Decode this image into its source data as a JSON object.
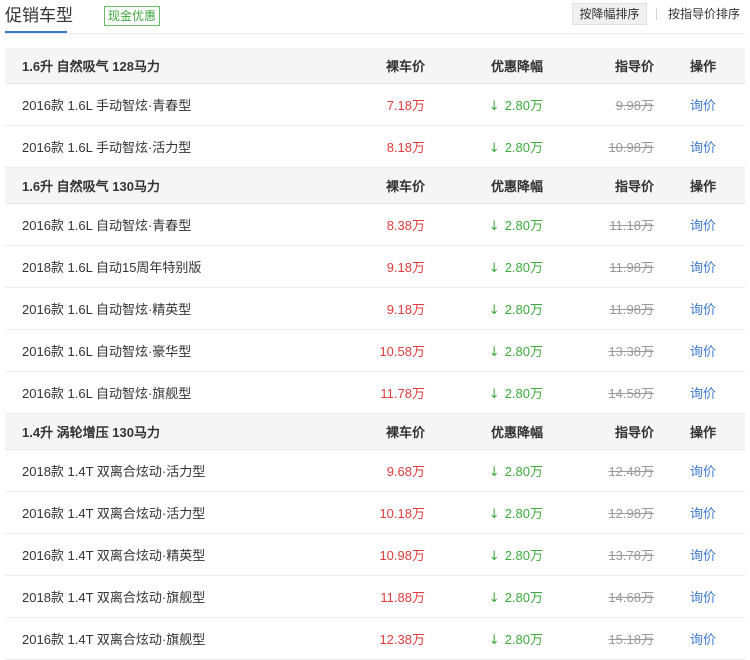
{
  "header": {
    "title": "促销车型",
    "badge": "现金优惠",
    "sort_buttons": [
      {
        "label": "按降幅排序",
        "active": true
      },
      {
        "label": "按指导价排序",
        "active": false
      }
    ]
  },
  "columns": {
    "price": "裸车价",
    "discount": "优惠降幅",
    "msrp": "指导价",
    "action": "操作"
  },
  "groups": [
    {
      "name": "1.6升 自然吸气 128马力",
      "rows": [
        {
          "model": "2016款 1.6L 手动智炫·青春型",
          "price": "7.18万",
          "discount": "2.80万",
          "msrp": "9.98万",
          "action": "询价"
        },
        {
          "model": "2016款 1.6L 手动智炫·活力型",
          "price": "8.18万",
          "discount": "2.80万",
          "msrp": "10.98万",
          "action": "询价"
        }
      ]
    },
    {
      "name": "1.6升 自然吸气 130马力",
      "rows": [
        {
          "model": "2016款 1.6L 自动智炫·青春型",
          "price": "8.38万",
          "discount": "2.80万",
          "msrp": "11.18万",
          "action": "询价"
        },
        {
          "model": "2018款 1.6L 自动15周年特别版",
          "price": "9.18万",
          "discount": "2.80万",
          "msrp": "11.98万",
          "action": "询价"
        },
        {
          "model": "2016款 1.6L 自动智炫·精英型",
          "price": "9.18万",
          "discount": "2.80万",
          "msrp": "11.98万",
          "action": "询价"
        },
        {
          "model": "2016款 1.6L 自动智炫·豪华型",
          "price": "10.58万",
          "discount": "2.80万",
          "msrp": "13.38万",
          "action": "询价"
        },
        {
          "model": "2016款 1.6L 自动智炫·旗舰型",
          "price": "11.78万",
          "discount": "2.80万",
          "msrp": "14.58万",
          "action": "询价"
        }
      ]
    },
    {
      "name": "1.4升 涡轮增压 130马力",
      "rows": [
        {
          "model": "2018款 1.4T 双离合炫动·活力型",
          "price": "9.68万",
          "discount": "2.80万",
          "msrp": "12.48万",
          "action": "询价"
        },
        {
          "model": "2016款 1.4T 双离合炫动·活力型",
          "price": "10.18万",
          "discount": "2.80万",
          "msrp": "12.98万",
          "action": "询价"
        },
        {
          "model": "2016款 1.4T 双离合炫动·精英型",
          "price": "10.98万",
          "discount": "2.80万",
          "msrp": "13.78万",
          "action": "询价"
        },
        {
          "model": "2018款 1.4T 双离合炫动·旗舰型",
          "price": "11.88万",
          "discount": "2.80万",
          "msrp": "14.68万",
          "action": "询价"
        },
        {
          "model": "2016款 1.4T 双离合炫动·旗舰型",
          "price": "12.38万",
          "discount": "2.80万",
          "msrp": "15.18万",
          "action": "询价"
        }
      ]
    }
  ],
  "icons": {
    "discount": "down-arrow-icon"
  },
  "colors": {
    "accent": "#3b78d0",
    "badge": "#3da83d",
    "price": "#e03c3c",
    "discount": "#3caa3c",
    "msrp": "#999999",
    "link": "#3b78d0"
  }
}
